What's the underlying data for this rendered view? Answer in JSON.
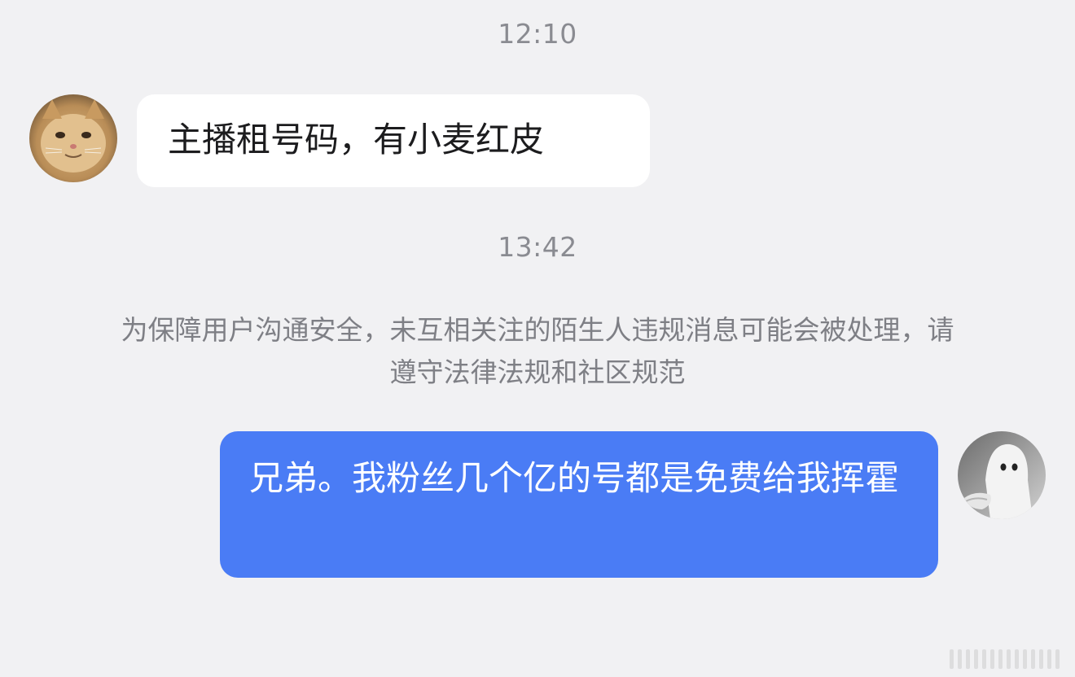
{
  "timestamps": [
    "12:10",
    "13:42"
  ],
  "messages": [
    {
      "direction": "incoming",
      "avatar": "cat-avatar",
      "text": "主播租号码，有小麦红皮"
    },
    {
      "direction": "outgoing",
      "avatar": "ghost-avatar",
      "text": "兄弟。我粉丝几个亿的号都是免费给我挥霍"
    }
  ],
  "system_notice": "为保障用户沟通安全，未互相关注的陌生人违规消息可能会被处理，请遵守法律法规和社区规范",
  "colors": {
    "background": "#f1f1f3",
    "incoming_bubble": "#ffffff",
    "outgoing_bubble": "#4a7cf5",
    "timestamp_text": "#8a8b91",
    "notice_text": "#7e7f85"
  }
}
